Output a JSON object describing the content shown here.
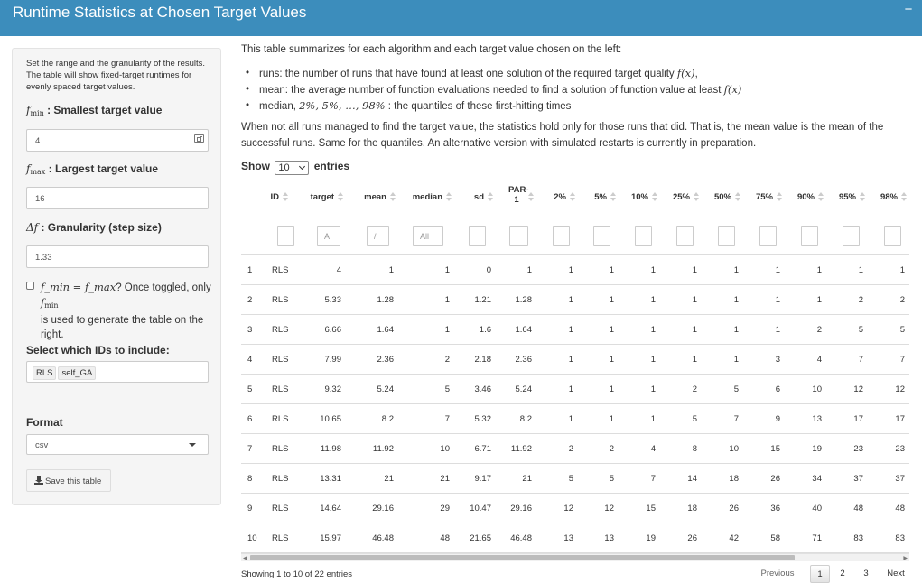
{
  "header": {
    "title": "Runtime Statistics at Chosen Target Values",
    "collapse_icon": "minus-icon",
    "color": "#3c8dbc"
  },
  "sidebar": {
    "description": "Set the range and the granularity of the results. The table will show fixed-target runtimes for evenly spaced target values.",
    "fmin": {
      "symbol": "f",
      "sub": "min",
      "label": " : Smallest target value",
      "value": "4"
    },
    "fmax": {
      "symbol": "f",
      "sub": "max",
      "label": " : Largest target value",
      "value": "16"
    },
    "step": {
      "symbol": "Δf",
      "label": " : Granularity (step size)",
      "value": "1.33"
    },
    "toggle": {
      "math": "f_min = f_max",
      "text1": "? Once toggled, only ",
      "text2": "is used to generate the table on the right.",
      "checked": false
    },
    "ids": {
      "label": "Select which IDs to include:",
      "selected": [
        "RLS",
        "self_GA"
      ]
    },
    "format": {
      "label": "Format",
      "value": "csv"
    },
    "save_button": "Save this table"
  },
  "main": {
    "intro": "This table summarizes for each algorithm and each target value chosen on the left:",
    "bullets": [
      {
        "prefix": "runs: the number of runs that have found at least one solution of the required target quality ",
        "math": "f(x)",
        "suffix": ","
      },
      {
        "prefix": "mean: the average number of function evaluations needed to find a solution of function value at least ",
        "math": "f(x)",
        "suffix": ""
      },
      {
        "prefix": "median, ",
        "math": "2%, 5%, …, 98%",
        "suffix": " : the quantiles of these first-hitting times"
      }
    ],
    "note": "When not all runs managed to find the target value, the statistics hold only for those runs that did. That is, the mean value is the mean of the successful runs. Same for the quantiles. An alternative version with simulated restarts is currently in preparation.",
    "show": {
      "before": "Show",
      "value": "10",
      "after": "entries"
    }
  },
  "table": {
    "columns": [
      "",
      "ID",
      "target",
      "mean",
      "median",
      "sd",
      "PAR-1",
      "2%",
      "5%",
      "10%",
      "25%",
      "50%",
      "75%",
      "90%",
      "95%",
      "98%"
    ],
    "filters": [
      "",
      "",
      "A",
      "/",
      "All",
      "",
      "",
      "",
      "",
      "",
      "",
      "",
      "",
      "",
      "",
      ""
    ],
    "rows": [
      [
        "1",
        "RLS",
        "4",
        "1",
        "1",
        "0",
        "1",
        "1",
        "1",
        "1",
        "1",
        "1",
        "1",
        "1",
        "1",
        "1"
      ],
      [
        "2",
        "RLS",
        "5.33",
        "1.28",
        "1",
        "1.21",
        "1.28",
        "1",
        "1",
        "1",
        "1",
        "1",
        "1",
        "1",
        "2",
        "2"
      ],
      [
        "3",
        "RLS",
        "6.66",
        "1.64",
        "1",
        "1.6",
        "1.64",
        "1",
        "1",
        "1",
        "1",
        "1",
        "1",
        "2",
        "5",
        "5"
      ],
      [
        "4",
        "RLS",
        "7.99",
        "2.36",
        "2",
        "2.18",
        "2.36",
        "1",
        "1",
        "1",
        "1",
        "1",
        "3",
        "4",
        "7",
        "7"
      ],
      [
        "5",
        "RLS",
        "9.32",
        "5.24",
        "5",
        "3.46",
        "5.24",
        "1",
        "1",
        "1",
        "2",
        "5",
        "6",
        "10",
        "12",
        "12"
      ],
      [
        "6",
        "RLS",
        "10.65",
        "8.2",
        "7",
        "5.32",
        "8.2",
        "1",
        "1",
        "1",
        "5",
        "7",
        "9",
        "13",
        "17",
        "17"
      ],
      [
        "7",
        "RLS",
        "11.98",
        "11.92",
        "10",
        "6.71",
        "11.92",
        "2",
        "2",
        "4",
        "8",
        "10",
        "15",
        "19",
        "23",
        "23"
      ],
      [
        "8",
        "RLS",
        "13.31",
        "21",
        "21",
        "9.17",
        "21",
        "5",
        "5",
        "7",
        "14",
        "18",
        "26",
        "34",
        "37",
        "37"
      ],
      [
        "9",
        "RLS",
        "14.64",
        "29.16",
        "29",
        "10.47",
        "29.16",
        "12",
        "12",
        "15",
        "18",
        "26",
        "36",
        "40",
        "48",
        "48"
      ],
      [
        "10",
        "RLS",
        "15.97",
        "46.48",
        "48",
        "21.65",
        "46.48",
        "13",
        "13",
        "19",
        "26",
        "42",
        "58",
        "71",
        "83",
        "83"
      ]
    ]
  },
  "footer": {
    "info": "Showing 1 to 10 of 22 entries",
    "pagination": {
      "previous": "Previous",
      "pages": [
        "1",
        "2",
        "3"
      ],
      "current": "1",
      "next": "Next"
    }
  }
}
